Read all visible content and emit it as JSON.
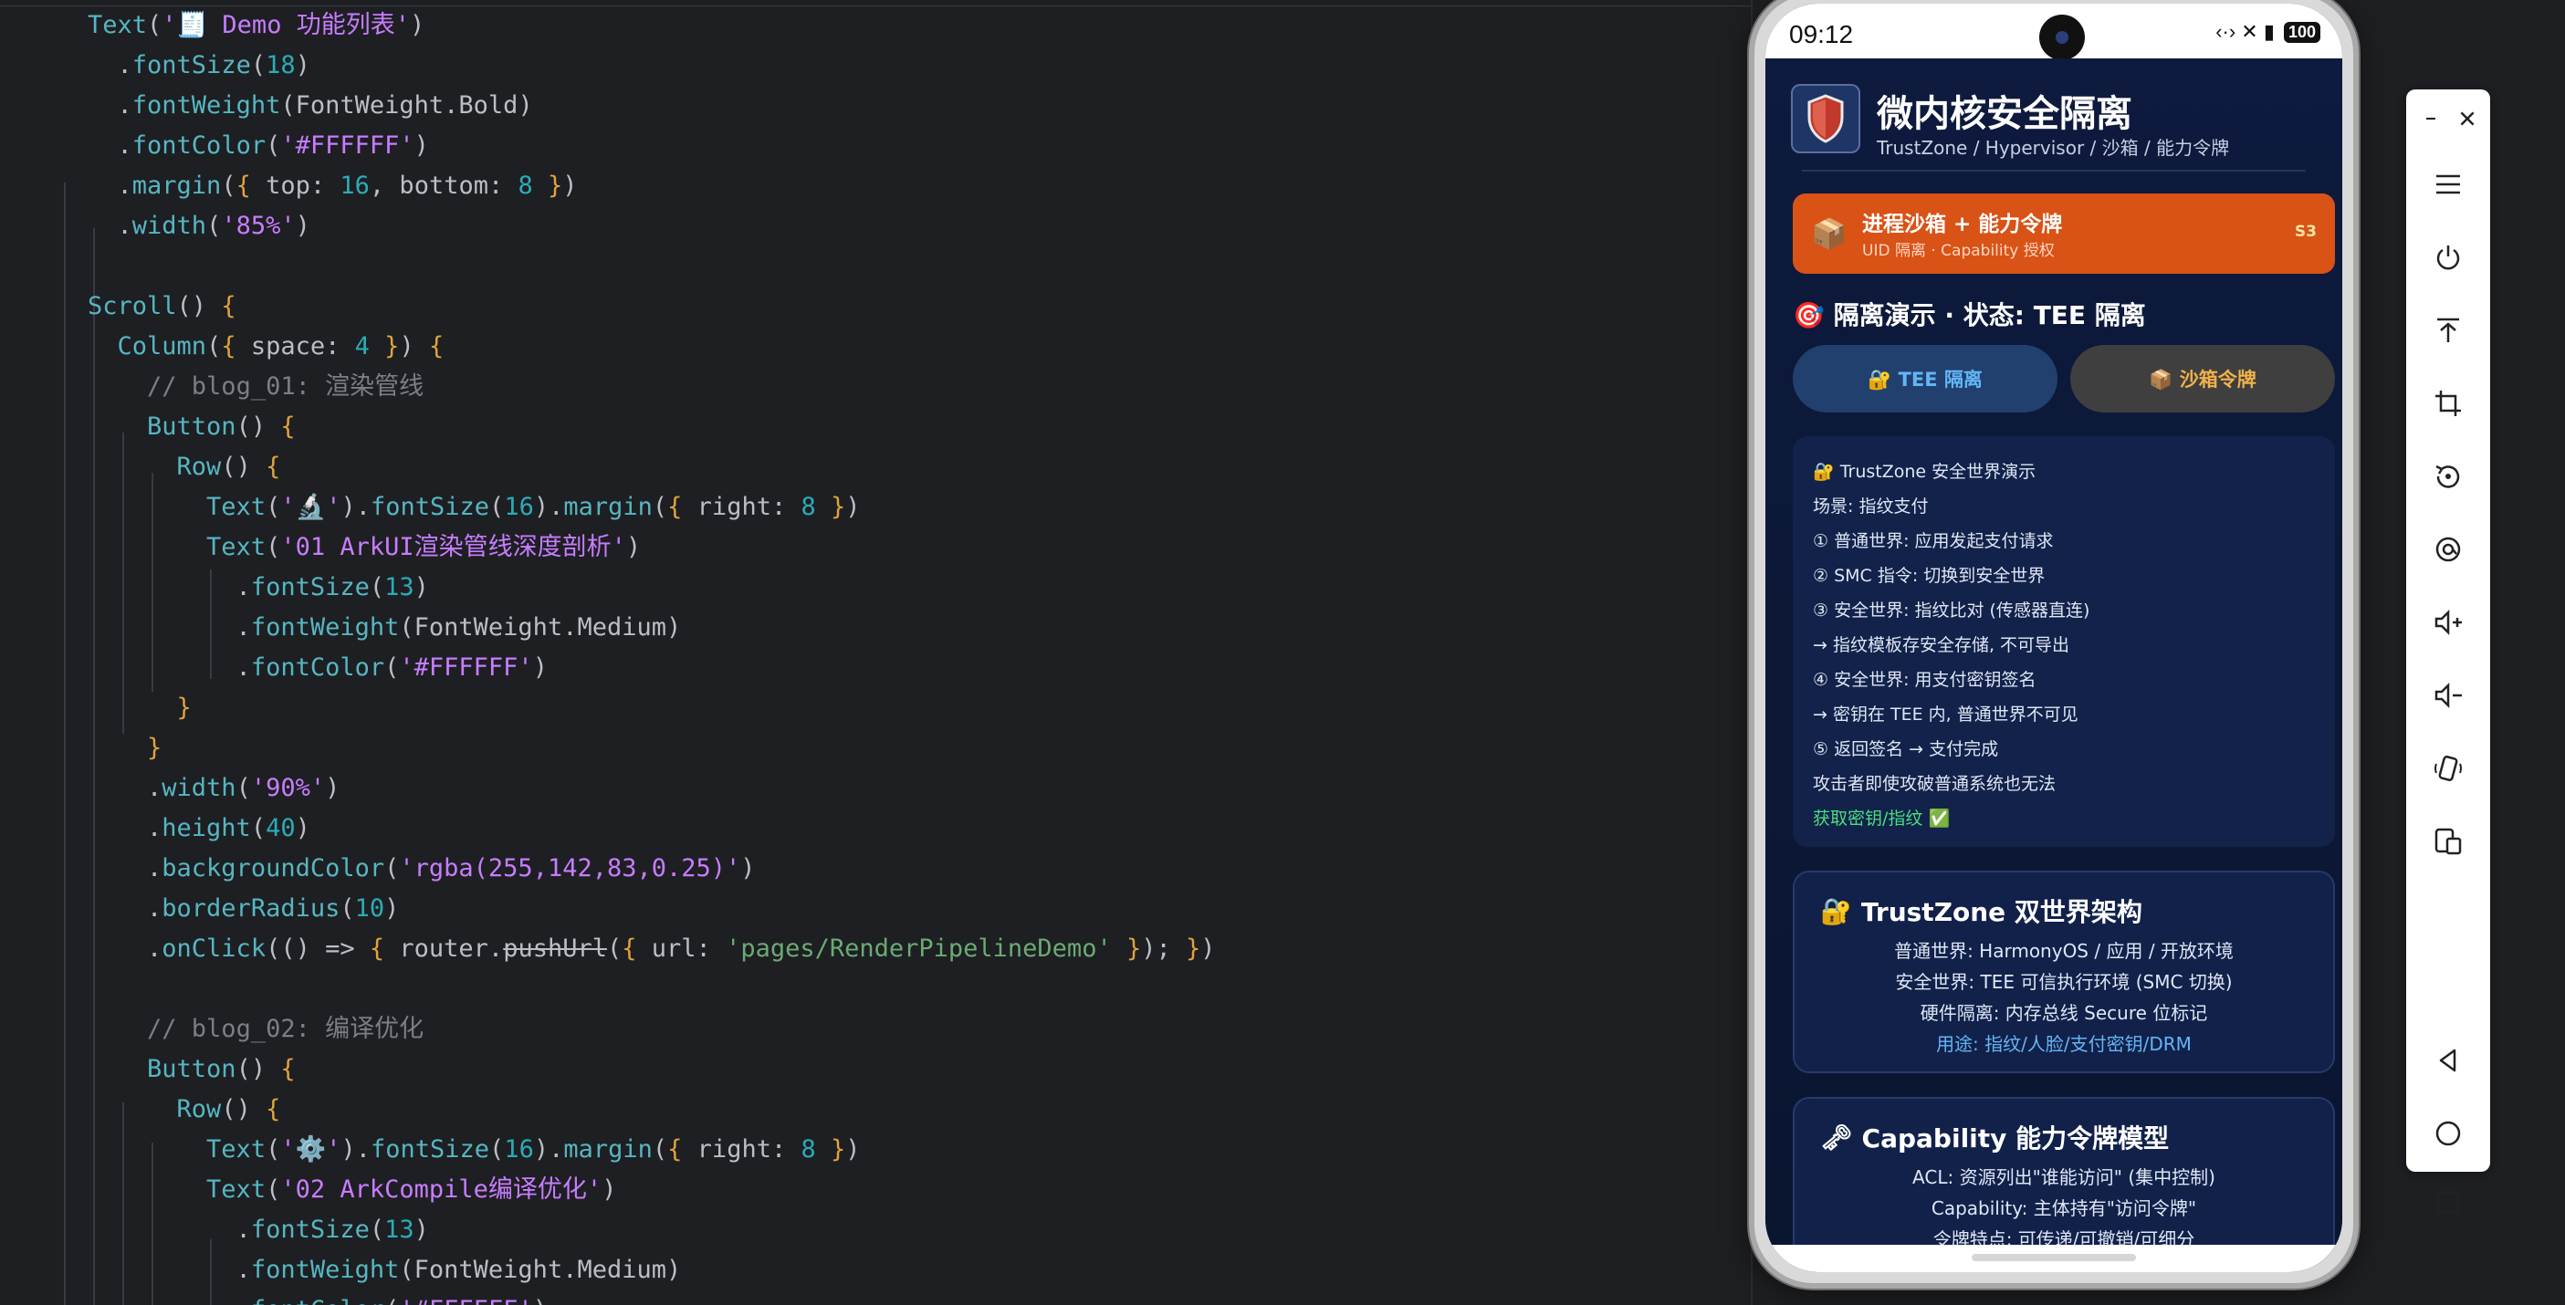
{
  "editor": {
    "lines": [
      [
        [
          "t-method",
          "Text"
        ],
        [
          "t-plain",
          "("
        ],
        [
          "t-str",
          "'🧾 Demo 功能列表'"
        ],
        [
          "t-plain",
          ")"
        ]
      ],
      [
        [
          "t-plain",
          "  ."
        ],
        [
          "t-method",
          "fontSize"
        ],
        [
          "t-plain",
          "("
        ],
        [
          "t-num",
          "18"
        ],
        [
          "t-plain",
          ")"
        ]
      ],
      [
        [
          "t-plain",
          "  ."
        ],
        [
          "t-method",
          "fontWeight"
        ],
        [
          "t-plain",
          "("
        ],
        [
          "t-plain",
          "FontWeight.Bold"
        ],
        [
          "t-plain",
          ")"
        ]
      ],
      [
        [
          "t-plain",
          "  ."
        ],
        [
          "t-method",
          "fontColor"
        ],
        [
          "t-plain",
          "("
        ],
        [
          "t-str",
          "'#FFFFFF'"
        ],
        [
          "t-plain",
          ")"
        ]
      ],
      [
        [
          "t-plain",
          "  ."
        ],
        [
          "t-method",
          "margin"
        ],
        [
          "t-plain",
          "("
        ],
        [
          "t-brace",
          "{"
        ],
        [
          "t-plain",
          " top: "
        ],
        [
          "t-num",
          "16"
        ],
        [
          "t-plain",
          ", bottom: "
        ],
        [
          "t-num",
          "8"
        ],
        [
          "t-plain",
          " "
        ],
        [
          "t-brace",
          "}"
        ],
        [
          "t-plain",
          ")"
        ]
      ],
      [
        [
          "t-plain",
          "  ."
        ],
        [
          "t-method",
          "width"
        ],
        [
          "t-plain",
          "("
        ],
        [
          "t-str",
          "'85%'"
        ],
        [
          "t-plain",
          ")"
        ]
      ],
      [],
      [
        [
          "t-method",
          "Scroll"
        ],
        [
          "t-plain",
          "() "
        ],
        [
          "t-brace",
          "{"
        ]
      ],
      [
        [
          "t-plain",
          "  "
        ],
        [
          "t-method",
          "Column"
        ],
        [
          "t-plain",
          "("
        ],
        [
          "t-brace",
          "{"
        ],
        [
          "t-plain",
          " space: "
        ],
        [
          "t-num",
          "4"
        ],
        [
          "t-plain",
          " "
        ],
        [
          "t-brace",
          "}"
        ],
        [
          "t-plain",
          ") "
        ],
        [
          "t-brace",
          "{"
        ]
      ],
      [
        [
          "t-plain",
          "    "
        ],
        [
          "t-comment",
          "// blog_01: 渲染管线"
        ]
      ],
      [
        [
          "t-plain",
          "    "
        ],
        [
          "t-method",
          "Button"
        ],
        [
          "t-plain",
          "() "
        ],
        [
          "t-brace",
          "{"
        ]
      ],
      [
        [
          "t-plain",
          "      "
        ],
        [
          "t-method",
          "Row"
        ],
        [
          "t-plain",
          "() "
        ],
        [
          "t-brace",
          "{"
        ]
      ],
      [
        [
          "t-plain",
          "        "
        ],
        [
          "t-method",
          "Text"
        ],
        [
          "t-plain",
          "("
        ],
        [
          "t-str",
          "'🔬'"
        ],
        [
          "t-plain",
          ")."
        ],
        [
          "t-method",
          "fontSize"
        ],
        [
          "t-plain",
          "("
        ],
        [
          "t-num",
          "16"
        ],
        [
          "t-plain",
          ")."
        ],
        [
          "t-method",
          "margin"
        ],
        [
          "t-plain",
          "("
        ],
        [
          "t-brace",
          "{"
        ],
        [
          "t-plain",
          " right: "
        ],
        [
          "t-num",
          "8"
        ],
        [
          "t-plain",
          " "
        ],
        [
          "t-brace",
          "}"
        ],
        [
          "t-plain",
          ")"
        ]
      ],
      [
        [
          "t-plain",
          "        "
        ],
        [
          "t-method",
          "Text"
        ],
        [
          "t-plain",
          "("
        ],
        [
          "t-str",
          "'01 ArkUI渲染管线深度剖析'"
        ],
        [
          "t-plain",
          ")"
        ]
      ],
      [
        [
          "t-plain",
          "          ."
        ],
        [
          "t-method",
          "fontSize"
        ],
        [
          "t-plain",
          "("
        ],
        [
          "t-num",
          "13"
        ],
        [
          "t-plain",
          ")"
        ]
      ],
      [
        [
          "t-plain",
          "          ."
        ],
        [
          "t-method",
          "fontWeight"
        ],
        [
          "t-plain",
          "("
        ],
        [
          "t-plain",
          "FontWeight.Medium"
        ],
        [
          "t-plain",
          ")"
        ]
      ],
      [
        [
          "t-plain",
          "          ."
        ],
        [
          "t-method",
          "fontColor"
        ],
        [
          "t-plain",
          "("
        ],
        [
          "t-str",
          "'#FFFFFF'"
        ],
        [
          "t-plain",
          ")"
        ]
      ],
      [
        [
          "t-plain",
          "      "
        ],
        [
          "t-brace",
          "}"
        ]
      ],
      [
        [
          "t-plain",
          "    "
        ],
        [
          "t-brace",
          "}"
        ]
      ],
      [
        [
          "t-plain",
          "    ."
        ],
        [
          "t-method",
          "width"
        ],
        [
          "t-plain",
          "("
        ],
        [
          "t-str",
          "'90%'"
        ],
        [
          "t-plain",
          ")"
        ]
      ],
      [
        [
          "t-plain",
          "    ."
        ],
        [
          "t-method",
          "height"
        ],
        [
          "t-plain",
          "("
        ],
        [
          "t-num",
          "40"
        ],
        [
          "t-plain",
          ")"
        ]
      ],
      [
        [
          "t-plain",
          "    ."
        ],
        [
          "t-method",
          "backgroundColor"
        ],
        [
          "t-plain",
          "("
        ],
        [
          "t-str",
          "'rgba(255,142,83,0.25)'"
        ],
        [
          "t-plain",
          ")"
        ]
      ],
      [
        [
          "t-plain",
          "    ."
        ],
        [
          "t-method",
          "borderRadius"
        ],
        [
          "t-plain",
          "("
        ],
        [
          "t-num",
          "10"
        ],
        [
          "t-plain",
          ")"
        ]
      ],
      [
        [
          "t-plain",
          "    ."
        ],
        [
          "t-method",
          "onClick"
        ],
        [
          "t-plain",
          "(() => "
        ],
        [
          "t-brace",
          "{"
        ],
        [
          "t-plain",
          " router."
        ],
        [
          "t-plain t-warn t-strike",
          "pushUrl"
        ],
        [
          "t-plain",
          "("
        ],
        [
          "t-brace",
          "{"
        ],
        [
          "t-plain",
          " url: "
        ],
        [
          "t-str2",
          "'pages/RenderPipelineDemo'"
        ],
        [
          "t-plain",
          " "
        ],
        [
          "t-brace",
          "}"
        ],
        [
          "t-plain",
          "); "
        ],
        [
          "t-brace",
          "}"
        ],
        [
          "t-plain",
          ")"
        ]
      ],
      [],
      [
        [
          "t-plain",
          "    "
        ],
        [
          "t-comment",
          "// blog_02: 编译优化"
        ]
      ],
      [
        [
          "t-plain",
          "    "
        ],
        [
          "t-method",
          "Button"
        ],
        [
          "t-plain",
          "() "
        ],
        [
          "t-brace",
          "{"
        ]
      ],
      [
        [
          "t-plain",
          "      "
        ],
        [
          "t-method",
          "Row"
        ],
        [
          "t-plain",
          "() "
        ],
        [
          "t-brace",
          "{"
        ]
      ],
      [
        [
          "t-plain",
          "        "
        ],
        [
          "t-method",
          "Text"
        ],
        [
          "t-plain",
          "("
        ],
        [
          "t-str",
          "'⚙️'"
        ],
        [
          "t-plain",
          ")."
        ],
        [
          "t-method",
          "fontSize"
        ],
        [
          "t-plain",
          "("
        ],
        [
          "t-num",
          "16"
        ],
        [
          "t-plain",
          ")."
        ],
        [
          "t-method",
          "margin"
        ],
        [
          "t-plain",
          "("
        ],
        [
          "t-brace",
          "{"
        ],
        [
          "t-plain",
          " right: "
        ],
        [
          "t-num",
          "8"
        ],
        [
          "t-plain",
          " "
        ],
        [
          "t-brace",
          "}"
        ],
        [
          "t-plain",
          ")"
        ]
      ],
      [
        [
          "t-plain",
          "        "
        ],
        [
          "t-method",
          "Text"
        ],
        [
          "t-plain",
          "("
        ],
        [
          "t-str",
          "'02 ArkCompile编译优化'"
        ],
        [
          "t-plain",
          ")"
        ]
      ],
      [
        [
          "t-plain",
          "          ."
        ],
        [
          "t-method",
          "fontSize"
        ],
        [
          "t-plain",
          "("
        ],
        [
          "t-num",
          "13"
        ],
        [
          "t-plain",
          ")"
        ]
      ],
      [
        [
          "t-plain",
          "          ."
        ],
        [
          "t-method",
          "fontWeight"
        ],
        [
          "t-plain",
          "("
        ],
        [
          "t-plain",
          "FontWeight.Medium"
        ],
        [
          "t-plain",
          ")"
        ]
      ],
      [
        [
          "t-plain",
          "          ."
        ],
        [
          "t-method",
          "fontColor"
        ],
        [
          "t-plain",
          "("
        ],
        [
          "t-str",
          "'#FFFFFF'"
        ],
        [
          "t-plain",
          ")"
        ]
      ]
    ]
  },
  "status": {
    "time": "09:12",
    "battery": "100",
    "indicators": "‹·› ✕ ▮"
  },
  "header": {
    "title": "微内核安全隔离",
    "subtitle": "TrustZone / Hypervisor / 沙箱 / 能力令牌",
    "icon": "shield-icon"
  },
  "banner": {
    "icon": "📦",
    "title": "进程沙箱 + 能力令牌",
    "subtitle": "UID 隔离 · Capability 授权",
    "badge": "S3"
  },
  "section": {
    "title": "🎯 隔离演示 · 状态: TEE 隔离"
  },
  "tabs": [
    {
      "label": "🔐 TEE 隔离"
    },
    {
      "label": "📦 沙箱令牌"
    }
  ],
  "log": {
    "lines": [
      "🔐 TrustZone 安全世界演示",
      "场景: 指纹支付",
      "① 普通世界: 应用发起支付请求",
      "② SMC 指令: 切换到安全世界",
      "③ 安全世界: 指纹比对 (传感器直连)",
      "  → 指纹模板存安全存储, 不可导出",
      "④ 安全世界: 用支付密钥签名",
      "  → 密钥在 TEE 内, 普通世界不可见",
      "⑤ 返回签名 → 支付完成",
      "攻击者即使攻破普通系统也无法"
    ],
    "ok_line": "获取密钥/指纹 ✅"
  },
  "card1": {
    "icon": "🔐",
    "title": "TrustZone 双世界架构",
    "lines": [
      "普通世界: HarmonyOS / 应用 / 开放环境",
      "安全世界: TEE 可信执行环境 (SMC 切换)",
      "硬件隔离: 内存总线 Secure 位标记"
    ],
    "highlight": "用途: 指纹/人脸/支付密钥/DRM"
  },
  "card2": {
    "icon": "🗝",
    "title": "Capability 能力令牌模型",
    "lines": [
      "ACL: 资源列出\"谁能访问\" (集中控制)",
      "Capability: 主体持有\"访问令牌\"",
      "令牌特点: 可传递/可撤销/可细分"
    ]
  },
  "toolbar": {
    "items": [
      "minimize-icon",
      "close-icon",
      "menu-icon",
      "power-icon",
      "upload-icon",
      "crop-icon",
      "rotate-icon",
      "screenshot-icon",
      "volume-up-icon",
      "volume-down-icon",
      "shake-icon",
      "device-icon",
      "back-icon",
      "home-icon",
      "recent-icon"
    ]
  }
}
